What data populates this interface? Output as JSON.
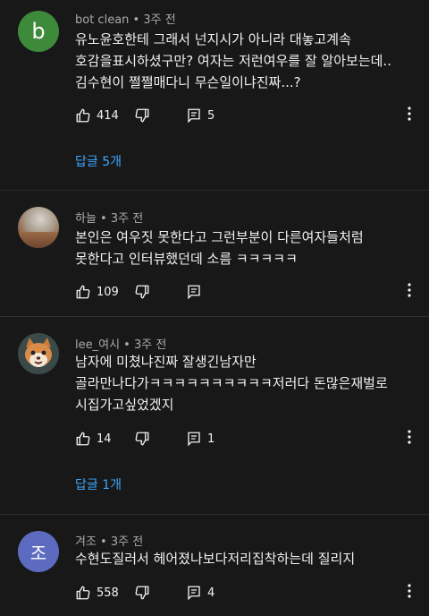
{
  "comments": [
    {
      "author": "bot clean",
      "time": "3주 전",
      "avatar_letter": "b",
      "avatar_color": "#3d8a3a",
      "lines": "유노윤호한테 그래서 넌지시가 아니라 대놓고계속\n호감을표시하셨구만?  여자는 저런여우를 잘 알아보는데..\n김수현이 쩔쩔매다니 무슨일이냐진짜...?",
      "likes": "414",
      "replies_count": "5",
      "reply_link": "답글 5개"
    },
    {
      "author": "하늘",
      "time": "3주 전",
      "lines": "본인은 여우짓 못한다고 그런부분이 다른여자들처럼\n못한다고 인터뷰했던데 소름 ㅋㅋㅋㅋㅋ",
      "likes": "109",
      "replies_count": ""
    },
    {
      "author": "lee_여시",
      "time": "3주 전",
      "lines": "남자에 미쳤냐진짜 잘생긴남자만\n골라만나다가ㅋㅋㅋㅋㅋㅋㅋㅋㅋㅋ저러다 돈많은재벌로\n시집가고싶었겠지",
      "likes": "14",
      "replies_count": "1",
      "reply_link": "답글 1개"
    },
    {
      "author": "겨조",
      "time": "3주 전",
      "avatar_letter": "조",
      "avatar_color": "#5c6bc0",
      "lines": "수현도질러서 헤어졌나보다저리집착하는데  질리지",
      "likes": "558",
      "replies_count": "4"
    }
  ],
  "meta_separator": " • ",
  "icons": {
    "like": "thumbs-up-icon",
    "dislike": "thumbs-down-icon",
    "reply": "comment-icon",
    "more": "more-vertical-icon"
  },
  "colors": {
    "background": "#181818",
    "text": "#f1f1f1",
    "meta": "#aaaaaa",
    "link": "#3ea6ff"
  }
}
